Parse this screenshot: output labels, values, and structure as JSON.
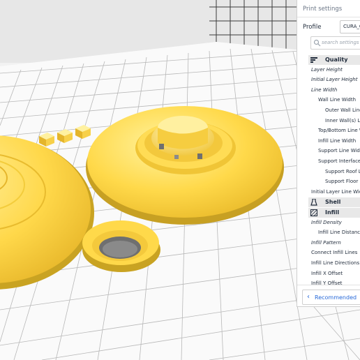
{
  "viewport": {
    "bed_color": "#fafafa",
    "grid_color": "#b8b8b8",
    "wall_color": "#e7e7e7",
    "model_color": "#ffd94a",
    "shadow_color": "#c8a21e",
    "hole_color": "#6f6f6f",
    "wall_grid_color": "#2e2e2e"
  },
  "panel": {
    "title": "Print settings",
    "profile_label": "Profile",
    "profile_value": "CURA_C",
    "search_placeholder": "search settings",
    "items": [
      {
        "type": "category",
        "label": "Quality",
        "icon": "quality-icon"
      },
      {
        "type": "setting",
        "label": "Layer Height",
        "italic": true
      },
      {
        "type": "setting",
        "label": "Initial Layer Height",
        "italic": true
      },
      {
        "type": "setting",
        "label": "Line Width",
        "italic": true
      },
      {
        "type": "setting",
        "label": "Wall Line Width",
        "italic": false
      },
      {
        "type": "setting",
        "label": "Outer Wall Line W",
        "italic": false
      },
      {
        "type": "setting",
        "label": "Inner Wall(s) Line",
        "italic": false
      },
      {
        "type": "setting",
        "label": "Top/Bottom Line Wi",
        "italic": false
      },
      {
        "type": "setting",
        "label": "Infill Line Width",
        "italic": false
      },
      {
        "type": "setting",
        "label": "Support Line Width",
        "italic": false
      },
      {
        "type": "setting",
        "label": "Support Interface Li",
        "italic": false
      },
      {
        "type": "setting",
        "label": "Support Roof Lir",
        "italic": false
      },
      {
        "type": "setting",
        "label": "Support Floor Li",
        "italic": false
      },
      {
        "type": "setting",
        "label": "Initial Layer Line Width",
        "italic": false
      },
      {
        "type": "category",
        "label": "Shell",
        "icon": "shell-icon"
      },
      {
        "type": "category",
        "label": "Infill",
        "icon": "infill-icon"
      },
      {
        "type": "setting",
        "label": "Infill Density",
        "italic": true
      },
      {
        "type": "setting",
        "label": "Infill Line Distance",
        "italic": false
      },
      {
        "type": "setting",
        "label": "Infill Pattern",
        "italic": true
      },
      {
        "type": "setting",
        "label": "Connect Infill Lines",
        "italic": false
      },
      {
        "type": "setting",
        "label": "Infill Line Directions",
        "italic": false
      },
      {
        "type": "setting",
        "label": "Infill X Offset",
        "italic": false
      },
      {
        "type": "setting",
        "label": "Infill Y Offset",
        "italic": false
      }
    ],
    "recommended_label": "Recommended",
    "accent_color": "#2769d9"
  }
}
